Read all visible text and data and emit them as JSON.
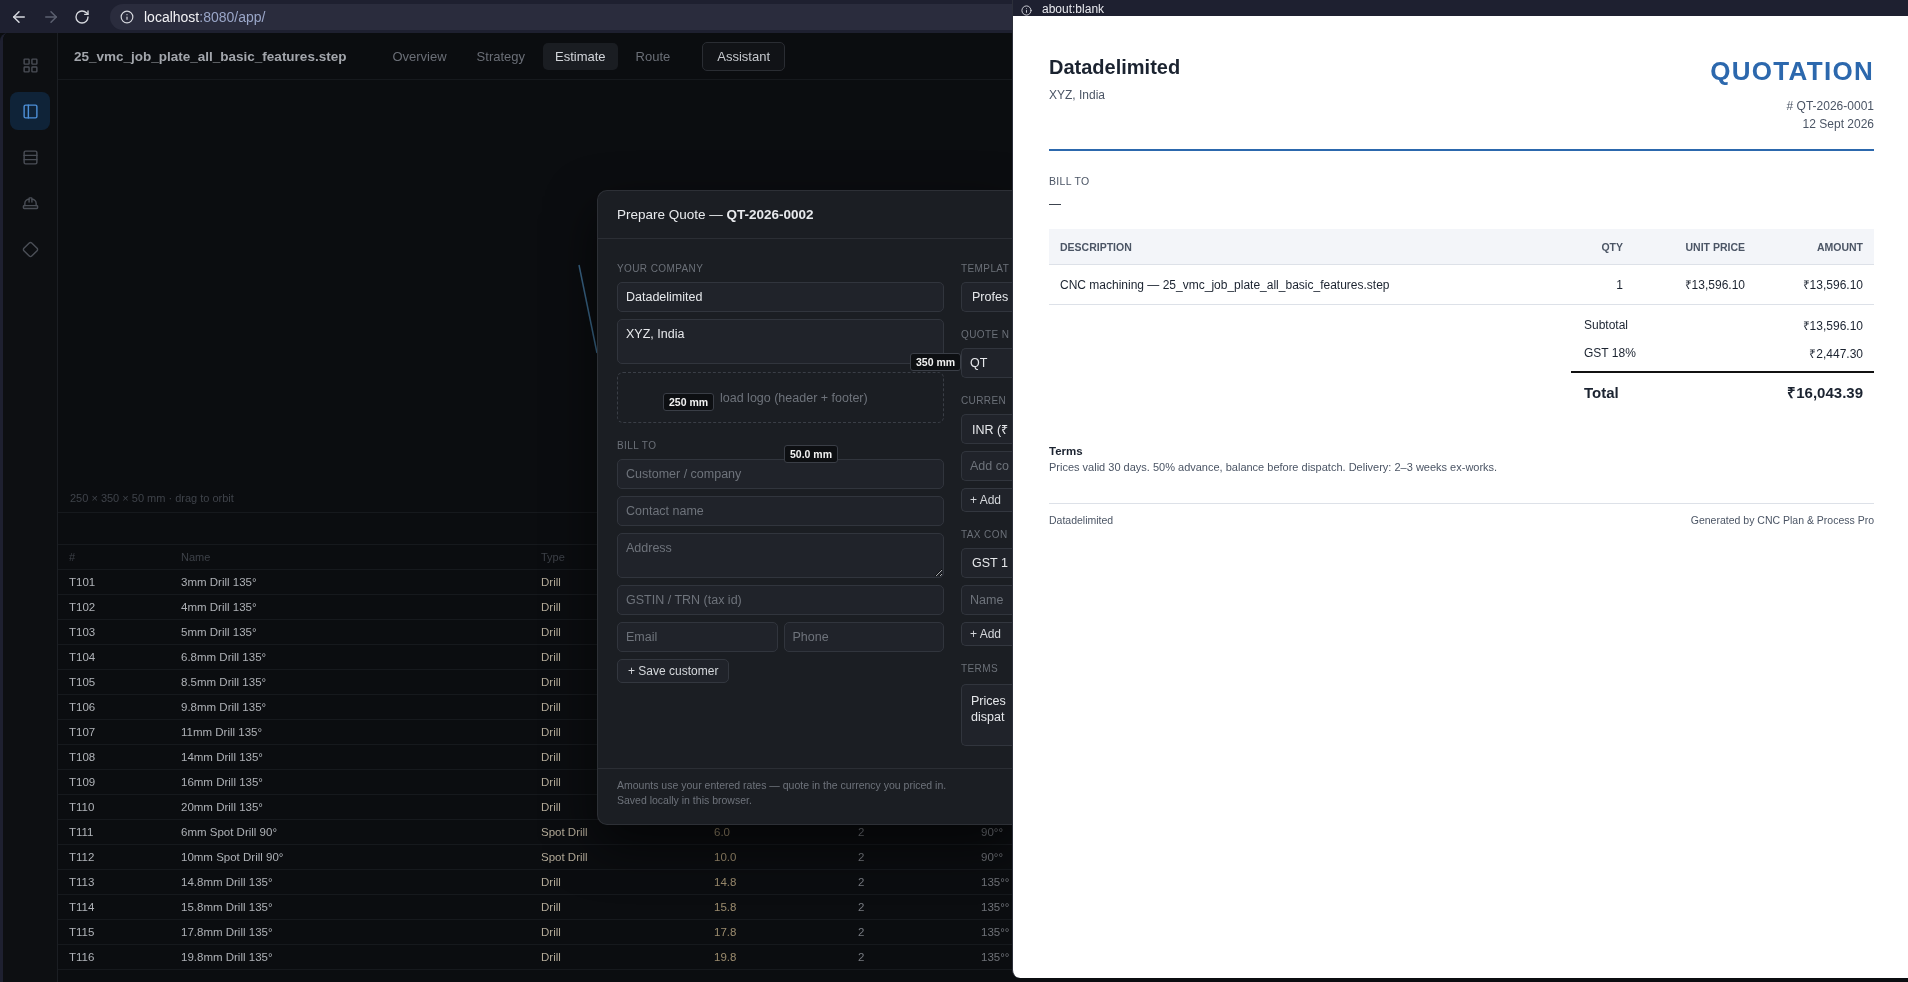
{
  "browser": {
    "url_host": "localhost",
    "url_path": ":8080/app/"
  },
  "sidebar": {
    "items": [
      {
        "selected": false
      },
      {
        "selected": true
      },
      {
        "selected": false
      },
      {
        "selected": false
      },
      {
        "selected": false
      }
    ]
  },
  "header": {
    "file_name": "25_vmc_job_plate_all_basic_features.step",
    "tabs": [
      {
        "label": "Overview",
        "selected": false
      },
      {
        "label": "Strategy",
        "selected": false
      },
      {
        "label": "Estimate",
        "selected": true
      },
      {
        "label": "Route",
        "selected": false
      }
    ],
    "assistant_button": "Assistant"
  },
  "viewport": {
    "caption": "250 × 350 × 50 mm · drag to orbit",
    "dimension_labels": [
      "350 mm",
      "250 mm",
      "50.0 mm"
    ]
  },
  "table": {
    "columns": [
      "#",
      "Name",
      "Type"
    ],
    "rows": [
      {
        "cells": [
          "T101",
          "3mm Drill 135°",
          "Drill"
        ]
      },
      {
        "cells": [
          "T102",
          "4mm Drill 135°",
          "Drill"
        ]
      },
      {
        "cells": [
          "T103",
          "5mm Drill 135°",
          "Drill"
        ]
      },
      {
        "cells": [
          "T104",
          "6.8mm Drill 135°",
          "Drill"
        ]
      },
      {
        "cells": [
          "T105",
          "8.5mm Drill 135°",
          "Drill"
        ]
      },
      {
        "cells": [
          "T106",
          "9.8mm Drill 135°",
          "Drill"
        ]
      },
      {
        "cells": [
          "T107",
          "11mm Drill 135°",
          "Drill"
        ]
      },
      {
        "cells": [
          "T108",
          "14mm Drill 135°",
          "Drill"
        ]
      },
      {
        "cells": [
          "T109",
          "16mm Drill 135°",
          "Drill"
        ]
      },
      {
        "cells": [
          "T110",
          "20mm Drill 135°",
          "Drill"
        ]
      },
      {
        "cells": [
          "T111",
          "6mm Spot Drill 90°",
          "Spot Drill",
          "6.0",
          "2",
          "90°°"
        ]
      },
      {
        "cells": [
          "T112",
          "10mm Spot Drill 90°",
          "Spot Drill",
          "10.0",
          "2",
          "90°°"
        ]
      },
      {
        "cells": [
          "T113",
          "14.8mm Drill 135°",
          "Drill",
          "14.8",
          "2",
          "135°°"
        ]
      },
      {
        "cells": [
          "T114",
          "15.8mm Drill 135°",
          "Drill",
          "15.8",
          "2",
          "135°°"
        ]
      },
      {
        "cells": [
          "T115",
          "17.8mm Drill 135°",
          "Drill",
          "17.8",
          "2",
          "135°°"
        ]
      },
      {
        "cells": [
          "T116",
          "19.8mm Drill 135°",
          "Drill",
          "19.8",
          "2",
          "135°°"
        ]
      }
    ]
  },
  "quote_dialog": {
    "title": "Prepare Quote — **QT-2026-0002**",
    "your_company": {
      "label": "YOUR COMPANY",
      "name": "Datadelimited",
      "address": "XYZ, India",
      "logo_upload": "load logo (header + footer)"
    },
    "bill_to": {
      "label": "BILL TO",
      "customer": {
        "placeholder": "Customer / company"
      },
      "contact": {
        "placeholder": "Contact name"
      },
      "address": {
        "placeholder": "Address"
      },
      "tax_id": {
        "placeholder": "GSTIN / TRN (tax id)"
      },
      "email": {
        "placeholder": "Email"
      },
      "phone": {
        "placeholder": "Phone"
      },
      "save_button": "+ Save customer"
    },
    "right_column": [
      {
        "kind": "label",
        "text": "TEMPLAT"
      },
      {
        "kind": "select",
        "value": "Profes"
      },
      {
        "kind": "label",
        "text": "QUOTE N"
      },
      {
        "kind": "input",
        "value": "QT"
      },
      {
        "kind": "label",
        "text": "CURREN"
      },
      {
        "kind": "select",
        "value": "INR (₹"
      },
      {
        "kind": "input",
        "placeholder": "Add co"
      },
      {
        "kind": "button",
        "text": "+ Add"
      },
      {
        "kind": "label",
        "text": "TAX CON"
      },
      {
        "kind": "select",
        "value": "GST 1"
      },
      {
        "kind": "input",
        "placeholder": "Name"
      },
      {
        "kind": "button",
        "text": "+ Add"
      },
      {
        "kind": "label",
        "text": "TERMS"
      },
      {
        "kind": "textarea",
        "lines": [
          "Prices",
          "dispat"
        ]
      }
    ],
    "footer_lines": [
      "Amounts use your entered rates — quote in the currency you priced in.",
      "Saved locally in this browser."
    ]
  },
  "preview_window": {
    "address": "about:blank",
    "company": "Datadelimited",
    "company_address": "XYZ, India",
    "heading": "QUOTATION",
    "number": "# QT-2026-0001",
    "date": "12 Sept 2026",
    "bill_to_label": "BILL TO",
    "bill_to_value": "—",
    "items": {
      "columns": [
        "DESCRIPTION",
        "QTY",
        "UNIT PRICE",
        "AMOUNT"
      ],
      "rows": [
        {
          "cells": [
            "CNC machining — 25_vmc_job_plate_all_basic_features.step",
            "1",
            "₹13,596.10",
            "₹13,596.10"
          ]
        }
      ]
    },
    "totals": [
      {
        "kind": "line",
        "label": "Subtotal",
        "value": "₹13,596.10"
      },
      {
        "kind": "line",
        "label": "GST 18%",
        "value": "₹2,447.30"
      },
      {
        "kind": "total",
        "label": "Total",
        "value": "₹16,043.39"
      }
    ],
    "terms_title": "Terms",
    "terms_text": "Prices valid 30 days. 50% advance, balance before dispatch. Delivery: 2–3 weeks ex-works.",
    "footer_left": "Datadelimited",
    "footer_right": "Generated by CNC Plan & Process Pro"
  }
}
